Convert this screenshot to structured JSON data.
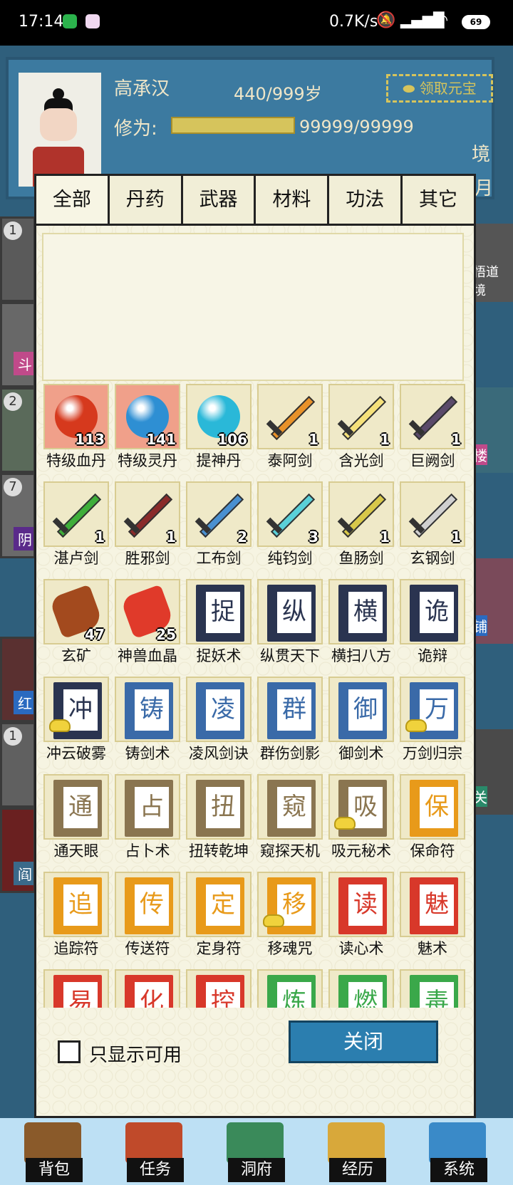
{
  "status_bar": {
    "time": "17:14",
    "network_speed": "0.7K/s",
    "battery": "69"
  },
  "header": {
    "player_name": "高承汉",
    "age": "440/999岁",
    "cultivation_label": "修为:",
    "cultivation_value": "99999/99999",
    "cultivation_progress": 1.0,
    "claim_button": "领取元宝",
    "realm_partial": "境",
    "month_partial": "月"
  },
  "side_cards_left": [
    {
      "badge": "1",
      "tag": ""
    },
    {
      "badge": "",
      "tag": "斗"
    },
    {
      "badge": "2",
      "tag": ""
    },
    {
      "badge": "7",
      "tag": "阴"
    },
    {
      "badge": "",
      "tag": "红"
    },
    {
      "badge": "1",
      "tag": ""
    },
    {
      "badge": "",
      "tag": "阎"
    }
  ],
  "side_cards_right": [
    {
      "tag": "悟道\n境"
    },
    {
      "tag": "楼"
    },
    {
      "tag": "铺"
    },
    {
      "tag": "关"
    }
  ],
  "tabs": [
    {
      "label": "全部",
      "active": true
    },
    {
      "label": "丹药",
      "active": false
    },
    {
      "label": "武器",
      "active": false
    },
    {
      "label": "材料",
      "active": false
    },
    {
      "label": "功法",
      "active": false
    },
    {
      "label": "其它",
      "active": false
    }
  ],
  "items": [
    {
      "name": "特级血丹",
      "count": "113",
      "kind": "orb",
      "color": "#d6391d",
      "bg": "hl"
    },
    {
      "name": "特级灵丹",
      "count": "141",
      "kind": "orb",
      "color": "#2e8fd3",
      "bg": "hl"
    },
    {
      "name": "提神丹",
      "count": "106",
      "kind": "orb",
      "color": "#2ab8d8",
      "bg": ""
    },
    {
      "name": "泰阿剑",
      "count": "1",
      "kind": "sword",
      "color": "#e8922a",
      "bg": ""
    },
    {
      "name": "含光剑",
      "count": "1",
      "kind": "sword",
      "color": "#f5e17a",
      "bg": ""
    },
    {
      "name": "巨阙剑",
      "count": "1",
      "kind": "sword",
      "color": "#5a4a6a",
      "bg": ""
    },
    {
      "name": "湛卢剑",
      "count": "1",
      "kind": "sword",
      "color": "#3fae3a",
      "bg": ""
    },
    {
      "name": "胜邪剑",
      "count": "1",
      "kind": "sword",
      "color": "#8a2a2a",
      "bg": ""
    },
    {
      "name": "工布剑",
      "count": "2",
      "kind": "sword",
      "color": "#4a90d0",
      "bg": ""
    },
    {
      "name": "纯钧剑",
      "count": "3",
      "kind": "sword",
      "color": "#5ad0d8",
      "bg": ""
    },
    {
      "name": "鱼肠剑",
      "count": "1",
      "kind": "sword",
      "color": "#d8c84a",
      "bg": ""
    },
    {
      "name": "玄钢剑",
      "count": "1",
      "kind": "sword",
      "color": "#d0d0d0",
      "bg": ""
    },
    {
      "name": "玄矿",
      "count": "47",
      "kind": "rock",
      "color": "#a34a1e",
      "bg": ""
    },
    {
      "name": "神兽血晶",
      "count": "25",
      "kind": "rock",
      "color": "#e03a2a",
      "bg": ""
    },
    {
      "name": "捉妖术",
      "char": "捉",
      "kind": "book",
      "color": "#2a3450",
      "bg": ""
    },
    {
      "name": "纵贯天下",
      "char": "纵",
      "kind": "book",
      "color": "#2a3450",
      "bg": ""
    },
    {
      "name": "横扫八方",
      "char": "横",
      "kind": "book",
      "color": "#2a3450",
      "bg": ""
    },
    {
      "name": "诡辩",
      "char": "诡",
      "kind": "book",
      "color": "#2a3450",
      "bg": ""
    },
    {
      "name": "冲云破雾",
      "char": "冲",
      "kind": "book",
      "color": "#2a3450",
      "bg": "",
      "ingot": true
    },
    {
      "name": "铸剑术",
      "char": "铸",
      "kind": "book",
      "color": "#3a6aa8",
      "bg": ""
    },
    {
      "name": "凌风剑诀",
      "char": "凌",
      "kind": "book",
      "color": "#3a6aa8",
      "bg": ""
    },
    {
      "name": "群伤剑影",
      "char": "群",
      "kind": "book",
      "color": "#3a6aa8",
      "bg": ""
    },
    {
      "name": "御剑术",
      "char": "御",
      "kind": "book",
      "color": "#3a6aa8",
      "bg": ""
    },
    {
      "name": "万剑归宗",
      "char": "万",
      "kind": "book",
      "color": "#3a6aa8",
      "bg": "",
      "ingot": true
    },
    {
      "name": "通天眼",
      "char": "通",
      "kind": "book",
      "color": "#8a7550",
      "bg": ""
    },
    {
      "name": "占卜术",
      "char": "占",
      "kind": "book",
      "color": "#8a7550",
      "bg": ""
    },
    {
      "name": "扭转乾坤",
      "char": "扭",
      "kind": "book",
      "color": "#8a7550",
      "bg": ""
    },
    {
      "name": "窥探天机",
      "char": "窥",
      "kind": "book",
      "color": "#8a7550",
      "bg": ""
    },
    {
      "name": "吸元秘术",
      "char": "吸",
      "kind": "book",
      "color": "#8a7550",
      "bg": "",
      "ingot": true
    },
    {
      "name": "保命符",
      "char": "保",
      "kind": "book",
      "color": "#e89a1a",
      "bg": ""
    },
    {
      "name": "追踪符",
      "char": "追",
      "kind": "book",
      "color": "#e89a1a",
      "bg": ""
    },
    {
      "name": "传送符",
      "char": "传",
      "kind": "book",
      "color": "#e89a1a",
      "bg": ""
    },
    {
      "name": "定身符",
      "char": "定",
      "kind": "book",
      "color": "#e89a1a",
      "bg": ""
    },
    {
      "name": "移魂咒",
      "char": "移",
      "kind": "book",
      "color": "#e89a1a",
      "bg": "",
      "ingot": true
    },
    {
      "name": "读心术",
      "char": "读",
      "kind": "book",
      "color": "#d8382a",
      "bg": ""
    },
    {
      "name": "魅术",
      "char": "魅",
      "kind": "book",
      "color": "#d8382a",
      "bg": ""
    },
    {
      "name": "",
      "char": "易",
      "kind": "book",
      "color": "#d8382a",
      "bg": ""
    },
    {
      "name": "",
      "char": "化",
      "kind": "book",
      "color": "#d8382a",
      "bg": ""
    },
    {
      "name": "",
      "char": "控",
      "kind": "book",
      "color": "#d8382a",
      "bg": ""
    },
    {
      "name": "",
      "char": "炼",
      "kind": "book",
      "color": "#3aa84a",
      "bg": ""
    },
    {
      "name": "",
      "char": "燃",
      "kind": "book",
      "color": "#3aa84a",
      "bg": ""
    },
    {
      "name": "",
      "char": "毒",
      "kind": "book",
      "color": "#3aa84a",
      "bg": ""
    }
  ],
  "footer": {
    "only_usable_label": "只显示可用",
    "only_usable_checked": false,
    "close_label": "关闭"
  },
  "bottom_nav": [
    {
      "label": "背包",
      "color": "#8a5a2a"
    },
    {
      "label": "任务",
      "color": "#c04a2a"
    },
    {
      "label": "洞府",
      "color": "#3a8a5a"
    },
    {
      "label": "经历",
      "color": "#d8a83a"
    },
    {
      "label": "系统",
      "color": "#3a8ac8"
    }
  ],
  "colors": {
    "accent": "#2b7eaf",
    "panel": "#f6f4e2",
    "highlight": "#f0a08a"
  }
}
